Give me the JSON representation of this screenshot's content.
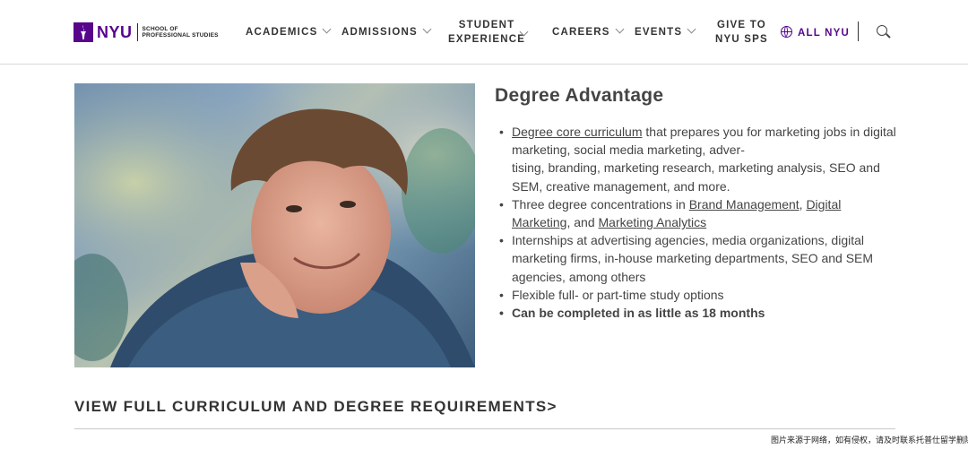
{
  "logo": {
    "brand": "NYU",
    "school_line1": "SCHOOL OF",
    "school_line2": "PROFESSIONAL STUDIES"
  },
  "nav": {
    "academics": "ACADEMICS",
    "admissions": "ADMISSIONS",
    "student_line1": "STUDENT",
    "student_line2": "EXPERIENCE",
    "careers": "CAREERS",
    "events": "EVENTS",
    "give_line1": "GIVE TO",
    "give_line2": "NYU SPS",
    "all_nyu": "ALL NYU"
  },
  "content": {
    "title": "Degree Advantage",
    "b1_link": "Degree core curriculum",
    "b1_text1": " that prepares you for marketing jobs in digital marketing, social media marketing, adver-",
    "b1_text2": "tising, branding, marketing research, marketing analysis, SEO and SEM, creative management, and more.",
    "b2_text1": "Three degree concentrations in ",
    "b2_link1": "Brand Management",
    "b2_sep1": ", ",
    "b2_link2": "Digital Marketing",
    "b2_sep2": ", and ",
    "b2_link3": "Marketing Analytics",
    "b3": "Internships at advertising agencies, media organizations, digital marketing firms, in-house marketing departments, SEO and SEM agencies, among others",
    "b4": "Flexible full- or part-time study options",
    "b5": "Can be completed in as little as 18 months"
  },
  "cta": "VIEW FULL CURRICULUM AND DEGREE REQUIREMENTS>",
  "watermark": "图片来源于网络，如有侵权，请及时联系托普仕留学删除",
  "colors": {
    "brand_purple": "#57068c",
    "text": "#444444"
  },
  "icons": [
    "torch-icon",
    "chevron-down-icon",
    "globe-icon",
    "search-icon"
  ]
}
